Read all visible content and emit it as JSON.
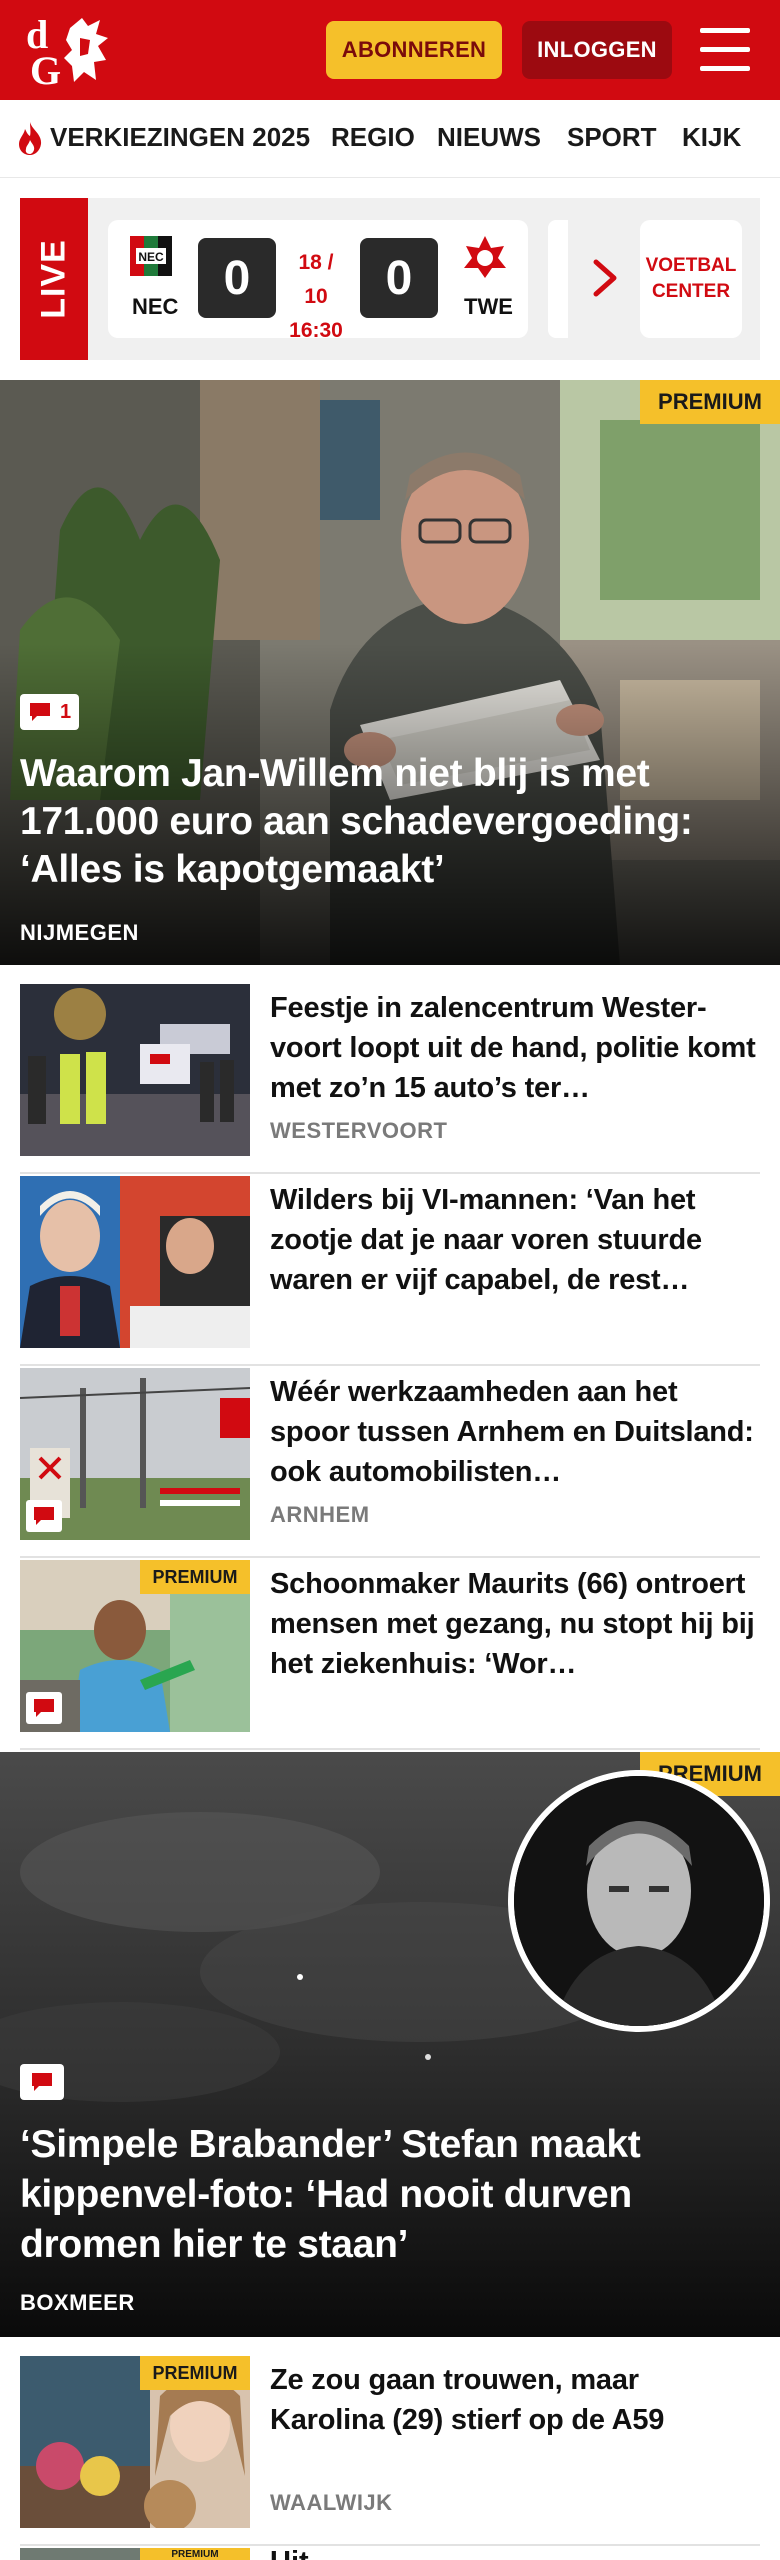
{
  "header": {
    "logo_text": "dG",
    "subscribe_label": "ABONNEREN",
    "login_label": "INLOGGEN",
    "brand_color": "#d10a11"
  },
  "nav": {
    "items": [
      {
        "label": "VERKIEZINGEN 2025",
        "icon": "flame-icon"
      },
      {
        "label": "REGIO"
      },
      {
        "label": "NIEUWS"
      },
      {
        "label": "SPORT"
      },
      {
        "label": "KIJK"
      }
    ]
  },
  "live": {
    "label": "LIVE",
    "match": {
      "home_code": "NEC",
      "away_code": "TWE",
      "home_score": "0",
      "away_score": "0",
      "date": "18 / 10",
      "time": "16:30"
    },
    "voetbal_center_label": "VOETBAL CENTER"
  },
  "hero": {
    "premium_label": "PREMIUM",
    "comment_count": "1",
    "title": "Waarom Jan-Willem niet blij is met 171.000 euro aan schadevergoeding: ‘Alles is kapotgemaakt’",
    "location": "NIJMEGEN"
  },
  "articles": [
    {
      "title": "Feestje in zalencentrum Wester-voort loopt uit de hand, politie komt met zo’n 15 auto’s ter…",
      "location": "WESTERVOORT",
      "premium": false,
      "comments": false
    },
    {
      "title": "Wilders bij VI-mannen: ‘Van het zootje dat je naar voren stuurde waren er vijf capabel, de rest…",
      "location": "",
      "premium": false,
      "comments": false
    },
    {
      "title": "Wéér werkzaamheden aan het spoor tussen Arnhem en Duitsland: ook automobilisten…",
      "location": "ARNHEM",
      "premium": false,
      "comments": true
    },
    {
      "title": "Schoonmaker Maurits (66) ontroert mensen met gezang, nu stopt hij bij het ziekenhuis: ‘Wor…",
      "location": "",
      "premium": true,
      "premium_label": "PREMIUM",
      "comments": true
    }
  ],
  "feature": {
    "premium_label": "PREMIUM",
    "title": "‘Simpele Brabander’ Stefan maakt kippenvel-foto: ‘Had nooit durven dromen hier te staan’",
    "location": "BOXMEER"
  },
  "articles_bottom": [
    {
      "title": "Ze zou gaan trouwen, maar Karolina (29) stierf op de A59",
      "location": "WAALWIJK",
      "premium": true,
      "premium_label": "PREMIUM"
    }
  ],
  "peek": {
    "premium_label": "PREMIUM",
    "title": "Uit…"
  }
}
